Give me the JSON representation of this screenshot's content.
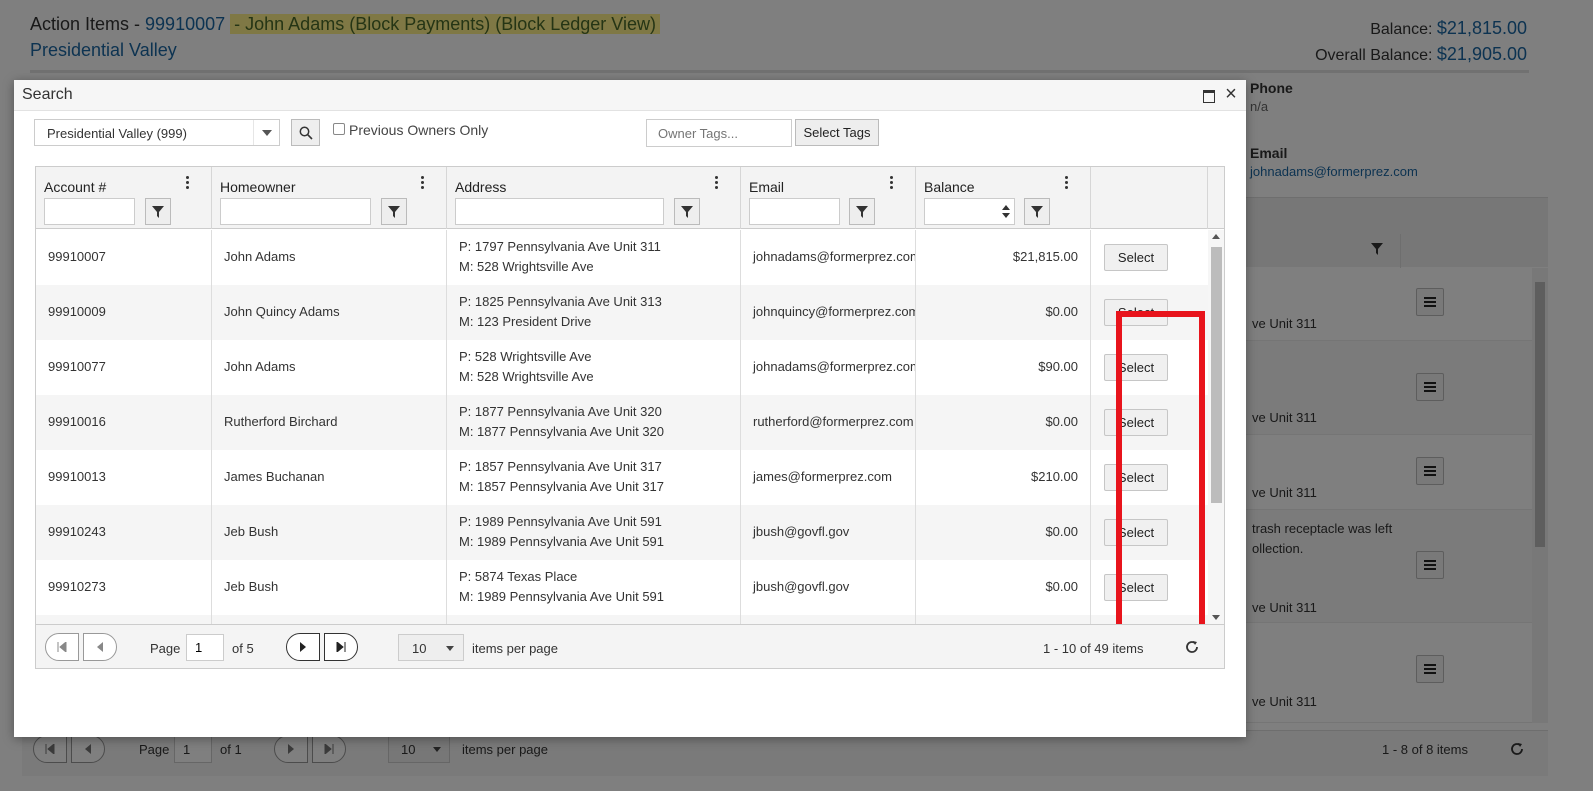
{
  "background": {
    "title_prefix": "Action Items - ",
    "account": "99910007",
    "title_highlight": "- John Adams (Block Payments) (Block Ledger View)",
    "subtitle": "Presidential Valley",
    "balance_label": "Balance: ",
    "balance_value": "$21,815.00",
    "overall_label": "Overall Balance: ",
    "overall_value": "$21,905.00",
    "phone_label": "Phone",
    "phone_value": "n/a",
    "email_label": "Email",
    "email_value": "johnadams@formerprez.com",
    "row_texts": [
      "ve Unit 311",
      "ve Unit 311",
      "ve Unit 311",
      "trash receptacle was left",
      "ollection.",
      "ve Unit 311",
      "ve Unit 311"
    ],
    "pager": {
      "page_label": "Page",
      "page_value": "1",
      "of_label": "of 1",
      "per_page_value": "10",
      "items_per_page": "items per page",
      "range": "1 - 8 of 8 items"
    }
  },
  "modal": {
    "title": "Search",
    "association_select": "Presidential Valley (999)",
    "previous_owners_label": "Previous Owners Only",
    "owner_tags_placeholder": "Owner Tags...",
    "select_tags_label": "Select Tags",
    "columns": [
      "Account #",
      "Homeowner",
      "Address",
      "Email",
      "Balance"
    ],
    "select_label": "Select",
    "rows": [
      {
        "account": "99910007",
        "homeowner": "John Adams",
        "addr_p": "P: 1797 Pennsylvania Ave Unit 311",
        "addr_m": "M: 528 Wrightsville Ave",
        "email": "johnadams@formerprez.com",
        "balance": "$21,815.00"
      },
      {
        "account": "99910009",
        "homeowner": "John Quincy Adams",
        "addr_p": "P: 1825 Pennsylvania Ave Unit 313",
        "addr_m": "M: 123 President Drive",
        "email": "johnquincy@formerprez.com",
        "balance": "$0.00"
      },
      {
        "account": "99910077",
        "homeowner": "John Adams",
        "addr_p": "P: 528 Wrightsville Ave",
        "addr_m": "M: 528 Wrightsville Ave",
        "email": "johnadams@formerprez.com",
        "balance": "$90.00"
      },
      {
        "account": "99910016",
        "homeowner": "Rutherford Birchard",
        "addr_p": "P: 1877 Pennsylvania Ave Unit 320",
        "addr_m": "M: 1877 Pennsylvania Ave Unit 320",
        "email": "rutherford@formerprez.com",
        "balance": "$0.00"
      },
      {
        "account": "99910013",
        "homeowner": "James Buchanan",
        "addr_p": "P: 1857 Pennsylvania Ave Unit 317",
        "addr_m": "M: 1857 Pennsylvania Ave Unit 317",
        "email": "james@formerprez.com",
        "balance": "$210.00"
      },
      {
        "account": "99910243",
        "homeowner": "Jeb Bush",
        "addr_p": "P: 1989 Pennsylvania Ave Unit 591",
        "addr_m": "M: 1989 Pennsylvania Ave Unit 591",
        "email": "jbush@govfl.gov",
        "balance": "$0.00"
      },
      {
        "account": "99910273",
        "homeowner": "Jeb Bush",
        "addr_p": "P: 5874 Texas Place",
        "addr_m": "M: 1989 Pennsylvania Ave Unit 591",
        "email": "jbush@govfl.gov",
        "balance": "$0.00"
      }
    ],
    "pager": {
      "page_label": "Page",
      "page_value": "1",
      "of_label": "of 5",
      "per_page_value": "10",
      "items_per_page": "items per page",
      "range": "1 - 10 of 49 items"
    }
  },
  "colors": {
    "link": "#1a66a3",
    "highlight": "#fff08a",
    "annotation_box": "#e8141c"
  }
}
